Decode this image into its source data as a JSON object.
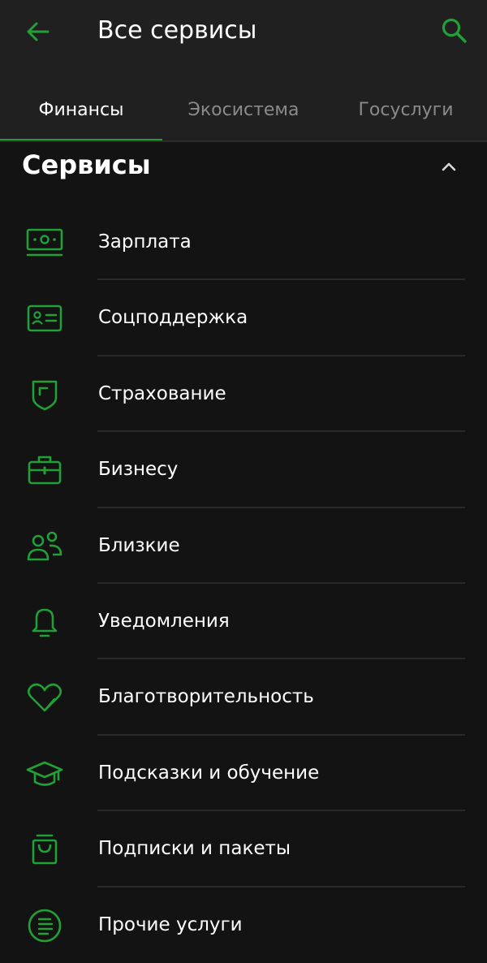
{
  "header": {
    "title": "Все сервисы",
    "back_icon": "arrow-left-icon",
    "search_icon": "search-icon"
  },
  "tabs": [
    {
      "label": "Финансы",
      "active": true
    },
    {
      "label": "Экосистема",
      "active": false
    },
    {
      "label": "Госуслуги",
      "active": false
    }
  ],
  "section": {
    "title": "Сервисы",
    "collapse_icon": "chevron-up-icon"
  },
  "items": [
    {
      "label": "Зарплата",
      "icon": "salary-icon"
    },
    {
      "label": "Соцподдержка",
      "icon": "id-card-icon"
    },
    {
      "label": "Страхование",
      "icon": "shield-icon"
    },
    {
      "label": "Бизнесу",
      "icon": "briefcase-icon"
    },
    {
      "label": "Близкие",
      "icon": "people-icon"
    },
    {
      "label": "Уведомления",
      "icon": "bell-icon"
    },
    {
      "label": "Благотворительность",
      "icon": "heart-icon"
    },
    {
      "label": "Подсказки и обучение",
      "icon": "graduation-cap-icon"
    },
    {
      "label": "Подписки и пакеты",
      "icon": "shopping-bag-icon"
    },
    {
      "label": "Прочие услуги",
      "icon": "list-circle-icon"
    }
  ],
  "colors": {
    "accent": "#21a038",
    "background": "#131313",
    "header_background": "#202020",
    "text_primary": "#ffffff",
    "text_secondary": "#8a8a8a"
  }
}
